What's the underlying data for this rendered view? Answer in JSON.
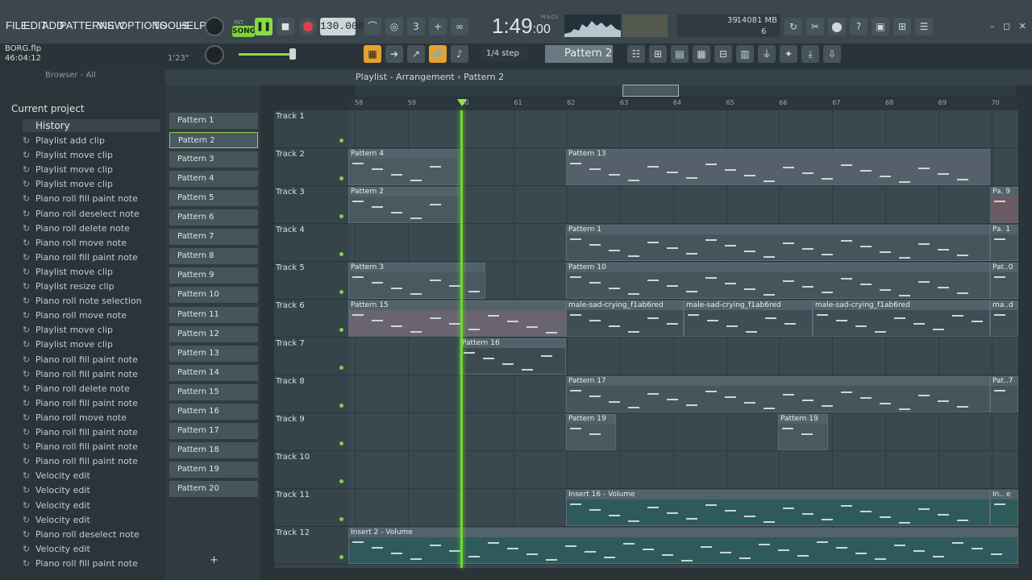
{
  "menu": [
    "FILE",
    "EDIT",
    "ADD",
    "PATTERNS",
    "VIEW",
    "OPTIONS",
    "TOOLS",
    "HELP"
  ],
  "file": {
    "name": "BORG.flp",
    "time": "46:04:12",
    "hint_time": "1'23\""
  },
  "transport": {
    "mode": "SONG",
    "pat_label": "PAT",
    "tempo": "130.000",
    "clock": "1:49",
    "clock_sub": ":00",
    "mscs": "M:S:CS"
  },
  "stats": {
    "mem": "14081 MB",
    "cpu": "39",
    "poly": "6"
  },
  "toolbar": {
    "step": "1/4 step",
    "pattern": "Pattern 2"
  },
  "browser": {
    "label": "Browser - All",
    "project": "Current project",
    "history": "History"
  },
  "history_items": [
    "Playlist add clip",
    "Playlist move clip",
    "Playlist move clip",
    "Playlist move clip",
    "Piano roll fill paint note",
    "Piano roll deselect note",
    "Piano roll delete note",
    "Piano roll move note",
    "Piano roll fill paint note",
    "Playlist move clip",
    "Playlist resize clip",
    "Piano roll note selection",
    "Piano roll move note",
    "Playlist move clip",
    "Playlist move clip",
    "Piano roll fill paint note",
    "Piano roll fill paint note",
    "Piano roll delete note",
    "Piano roll fill paint note",
    "Piano roll move note",
    "Piano roll fill paint note",
    "Piano roll fill paint note",
    "Piano roll fill paint note",
    "Velocity edit",
    "Velocity edit",
    "Velocity edit",
    "Velocity edit",
    "Piano roll deselect note",
    "Velocity edit",
    "Piano roll fill paint note"
  ],
  "patterns": [
    "Pattern 1",
    "Pattern 2",
    "Pattern 3",
    "Pattern 4",
    "Pattern 5",
    "Pattern 6",
    "Pattern 7",
    "Pattern 8",
    "Pattern 9",
    "Pattern 10",
    "Pattern 11",
    "Pattern 12",
    "Pattern 13",
    "Pattern 14",
    "Pattern 15",
    "Pattern 16",
    "Pattern 17",
    "Pattern 18",
    "Pattern 19",
    "Pattern 20"
  ],
  "playlist": {
    "title": "Playlist - Arrangement",
    "pattern": "Pattern 2"
  },
  "ruler": [
    "58",
    "59",
    "60",
    "61",
    "62",
    "63",
    "64",
    "65",
    "66",
    "67",
    "68",
    "69",
    "70"
  ],
  "tracks": [
    "Track 1",
    "Track 2",
    "Track 3",
    "Track 4",
    "Track 5",
    "Track 6",
    "Track 7",
    "Track 8",
    "Track 9",
    "Track 10",
    "Track 11",
    "Track 12"
  ],
  "clips": {
    "c1": "Pattern 4",
    "c2": "Pattern 13",
    "c3": "Pattern 2",
    "c4": "Pa. 9",
    "c5": "Pattern 1",
    "c6": "Pa. 1",
    "c7": "Pattern 3",
    "c8": "Pattern 10",
    "c9": "Pat..0",
    "c10": "Pattern 15",
    "c11": "male-sad-crying_f1ab6red",
    "c12": "male-sad-crying_f1ab6red",
    "c13": "male-sad-crying_f1ab6red",
    "c14": "ma..d",
    "c15": "Pattern 16",
    "c16": "Pattern 17",
    "c17": "Pat..7",
    "c18": "Pattern 19",
    "c19": "Pattern 19",
    "c20": "Insert 16 - Volume",
    "c21": "In.. e",
    "c22": "Insert 2 - Volume"
  },
  "plus": "+"
}
